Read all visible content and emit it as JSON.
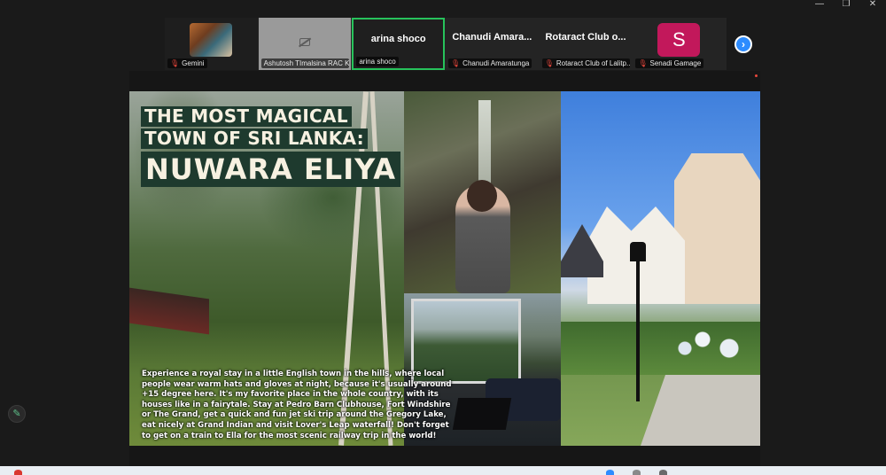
{
  "window": {
    "minimize_glyph": "—",
    "restore_glyph": "❐",
    "close_glyph": "✕"
  },
  "participants": [
    {
      "name": "",
      "label": "Gemini",
      "muted": true,
      "type": "video"
    },
    {
      "name": "",
      "label": "Ashutosh TImalsina RAC K...",
      "muted": false,
      "type": "camera-off"
    },
    {
      "name": "arina shoco",
      "label": "arina shoco",
      "muted": false,
      "type": "active-speaker"
    },
    {
      "name": "Chanudi  Amara...",
      "label": "Chanudi Amaratunga",
      "muted": true,
      "type": "name"
    },
    {
      "name": "Rotaract Club o...",
      "label": "Rotaract Club of Lalitp...",
      "muted": true,
      "type": "name"
    },
    {
      "name": "S",
      "label": "Senadi Gamage",
      "muted": true,
      "type": "avatar"
    }
  ],
  "next_button_glyph": "›",
  "slide": {
    "title_line1": "THE MOST MAGICAL",
    "title_line2": "TOWN OF SRI LANKA:",
    "title_big": "NUWARA ELIYA",
    "caption": "Experience a royal stay in a little English town in the hills, where local people wear warm hats and gloves at night, because it's usually around +15 degree here. It's my favorite place in the whole country, with its houses like in a fairytale. Stay at Pedro Barn Clubhouse, Fort Windshire or The Grand, get a quick and fun jet ski trip around the Gregory Lake, eat nicely at Grand Indian and visit Lover's Leap waterfall! Don't forget to get on a train to Ella for the most scenic railway trip in the world!"
  },
  "annotate_glyph": "✎",
  "colors": {
    "active_speaker_border": "#27c25b",
    "muted_mic": "#e8473c",
    "avatar_bg": "#c2185b",
    "next_button": "#2d8cff",
    "title_bg": "#1e3a2e"
  }
}
